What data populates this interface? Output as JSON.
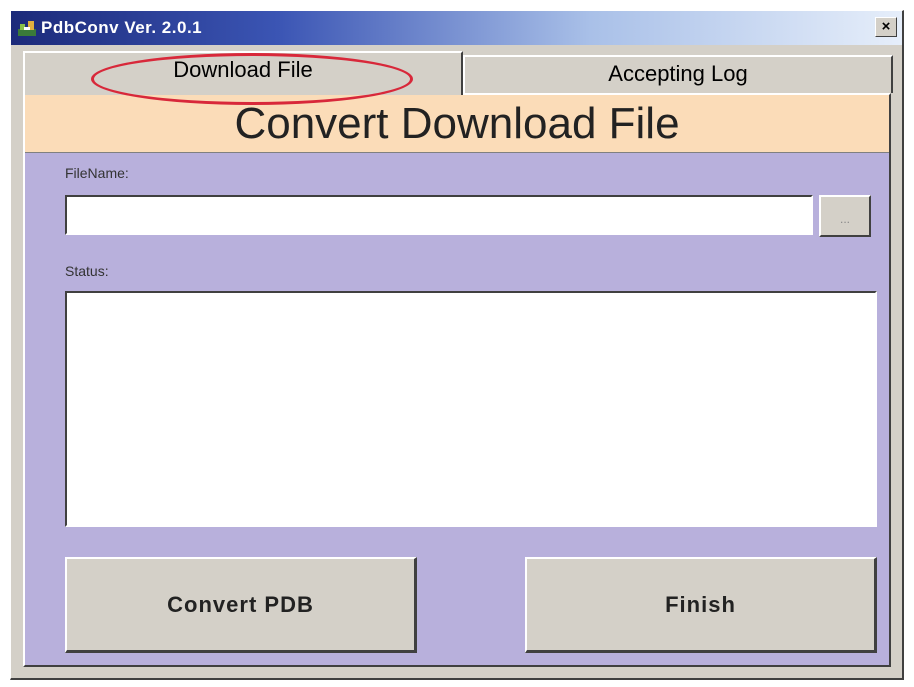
{
  "window": {
    "title": "PdbConv Ver. 2.0.1",
    "close_label": "×"
  },
  "tabs": [
    {
      "label": "Download File",
      "active": true,
      "highlighted": true
    },
    {
      "label": "Accepting Log",
      "active": false
    }
  ],
  "panel": {
    "banner_title": "Convert Download File",
    "filename_label": "FileName:",
    "filename_value": "",
    "browse_label": "...",
    "status_label": "Status:",
    "status_text": ""
  },
  "buttons": {
    "convert_label": "Convert PDB",
    "finish_label": "Finish"
  },
  "colors": {
    "panel_bg": "#b8b0dc",
    "banner_bg": "#fbdcb8",
    "highlight_ring": "#d8283a"
  }
}
